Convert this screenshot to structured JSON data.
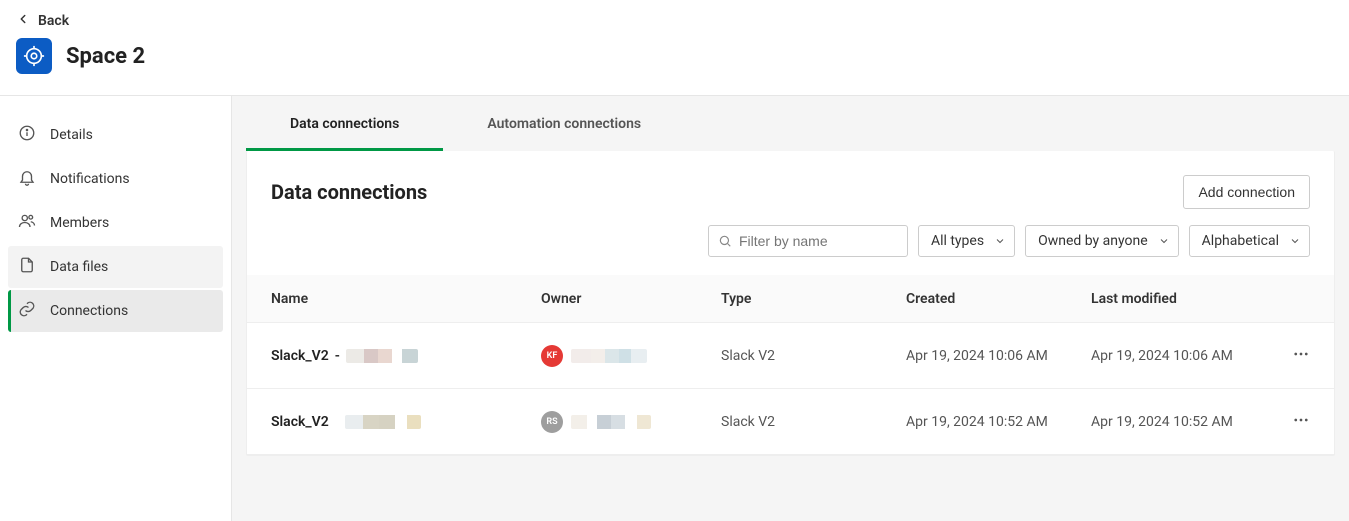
{
  "back_label": "Back",
  "space_title": "Space 2",
  "sidebar": [
    {
      "id": "details",
      "label": "Details"
    },
    {
      "id": "notifications",
      "label": "Notifications"
    },
    {
      "id": "members",
      "label": "Members"
    },
    {
      "id": "datafiles",
      "label": "Data files"
    },
    {
      "id": "connections",
      "label": "Connections"
    }
  ],
  "tabs": [
    {
      "id": "data",
      "label": "Data connections",
      "active": true
    },
    {
      "id": "automation",
      "label": "Automation connections",
      "active": false
    }
  ],
  "panel_title": "Data connections",
  "add_button": "Add connection",
  "search_placeholder": "Filter by name",
  "filters": {
    "type": "All types",
    "owner": "Owned by anyone",
    "sort": "Alphabetical"
  },
  "columns": {
    "name": "Name",
    "owner": "Owner",
    "type": "Type",
    "created": "Created",
    "modified": "Last modified"
  },
  "rows": [
    {
      "name": "Slack_V2",
      "name_suffix": " - ",
      "owner_initials": "KF",
      "owner_color": "red",
      "type": "Slack V2",
      "created": "Apr 19, 2024 10:06 AM",
      "modified": "Apr 19, 2024 10:06 AM"
    },
    {
      "name": "Slack_V2",
      "name_suffix": "",
      "owner_initials": "RS",
      "owner_color": "grey",
      "type": "Slack V2",
      "created": "Apr 19, 2024 10:52 AM",
      "modified": "Apr 19, 2024 10:52 AM"
    }
  ]
}
